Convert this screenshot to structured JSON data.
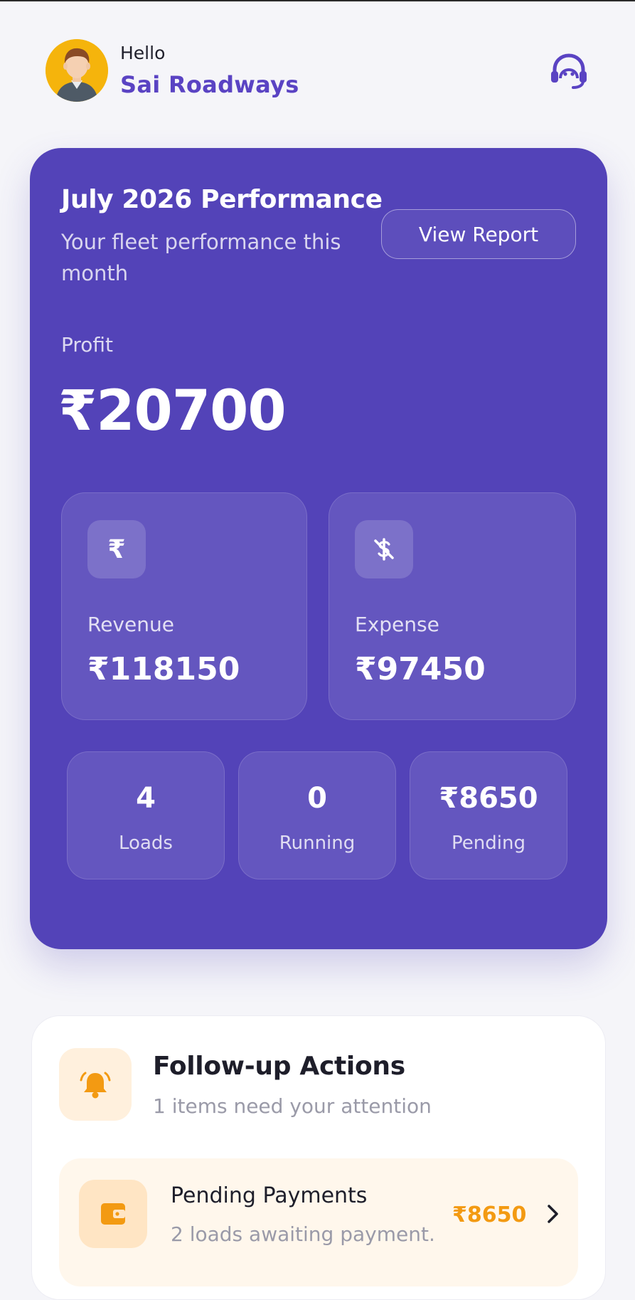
{
  "header": {
    "greeting": "Hello",
    "company_name": "Sai Roadways",
    "avatar_icon": "user-avatar",
    "support_icon": "headset-icon"
  },
  "performance": {
    "title": "July 2026 Performance",
    "subtitle": "Your fleet performance this month",
    "view_report_label": "View Report",
    "profit_label": "Profit",
    "profit_value": "₹20700",
    "revenue": {
      "icon": "rupee-icon",
      "label": "Revenue",
      "value": "₹118150"
    },
    "expense": {
      "icon": "no-money-icon",
      "label": "Expense",
      "value": "₹97450"
    },
    "stats": [
      {
        "value": "4",
        "label": "Loads"
      },
      {
        "value": "0",
        "label": "Running"
      },
      {
        "value": "₹8650",
        "label": "Pending"
      }
    ]
  },
  "followup": {
    "icon": "bell-icon",
    "title": "Follow-up Actions",
    "subtitle": "1 items need your attention",
    "items": [
      {
        "icon": "wallet-icon",
        "title": "Pending Payments",
        "subtitle": "2 loads awaiting payment.",
        "amount": "₹8650"
      }
    ]
  },
  "colors": {
    "primary": "#5343b8",
    "brand_text": "#5a43c3",
    "warning": "#f39a12",
    "background": "#f5f5f9"
  }
}
